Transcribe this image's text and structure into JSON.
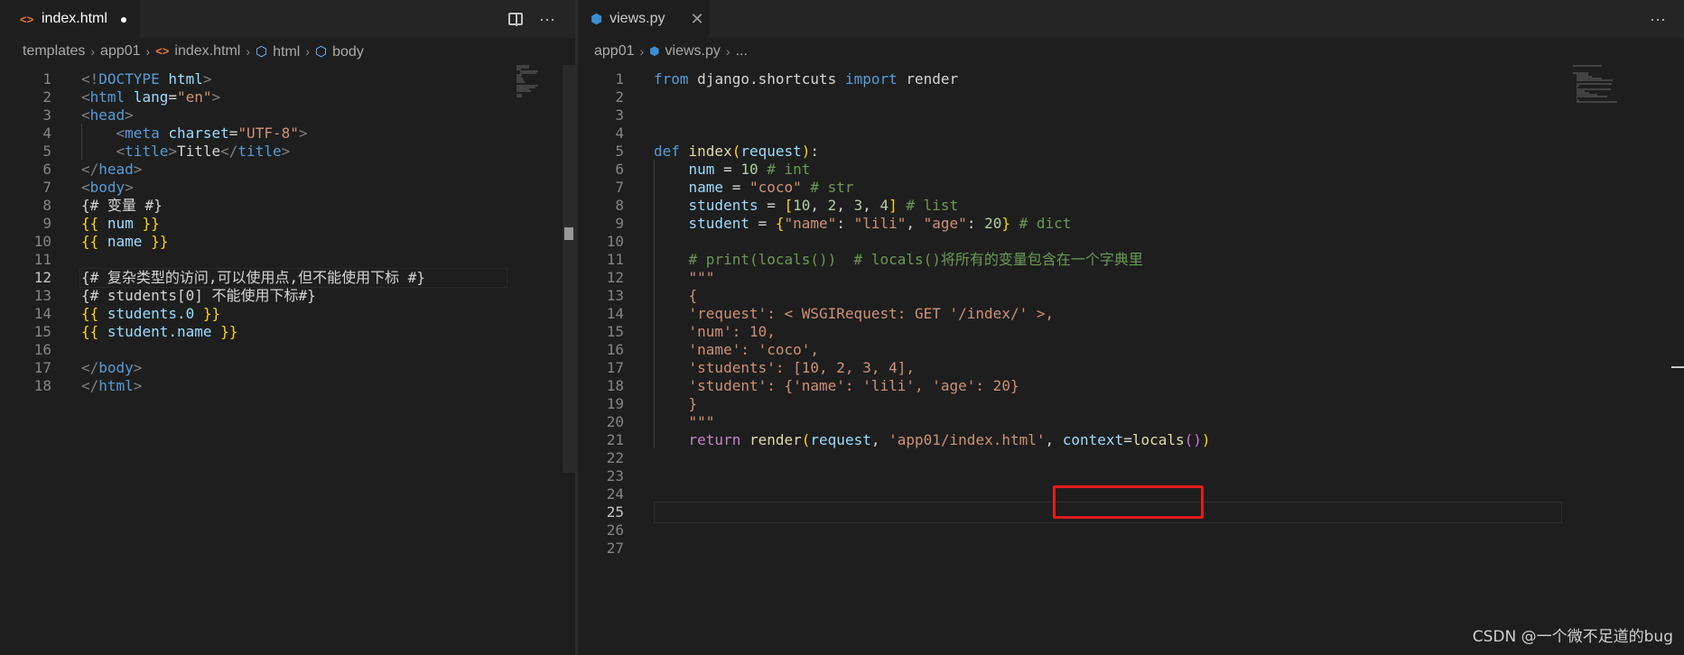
{
  "left_pane": {
    "tab": {
      "label": "index.html",
      "icon": "html-file-icon",
      "modified_dot": "●"
    },
    "breadcrumb": [
      "templates",
      "app01",
      "index.html",
      "html",
      "body"
    ],
    "active_line": 12,
    "lines": [
      {
        "n": "1",
        "tokens": [
          [
            "punc",
            "<!"
          ],
          [
            "tag",
            "DOCTYPE "
          ],
          [
            "attr",
            "html"
          ],
          [
            "punc",
            ">"
          ]
        ]
      },
      {
        "n": "2",
        "tokens": [
          [
            "punc",
            "<"
          ],
          [
            "tag",
            "html "
          ],
          [
            "attr",
            "lang"
          ],
          [
            "txt",
            "="
          ],
          [
            "str",
            "\"en\""
          ],
          [
            "punc",
            ">"
          ]
        ]
      },
      {
        "n": "3",
        "tokens": [
          [
            "punc",
            "<"
          ],
          [
            "tag",
            "head"
          ],
          [
            "punc",
            ">"
          ]
        ]
      },
      {
        "n": "4",
        "tokens": [
          [
            "txt",
            "    "
          ],
          [
            "punc",
            "<"
          ],
          [
            "tag",
            "meta "
          ],
          [
            "attr",
            "charset"
          ],
          [
            "txt",
            "="
          ],
          [
            "str",
            "\"UTF-8\""
          ],
          [
            "punc",
            ">"
          ]
        ]
      },
      {
        "n": "5",
        "tokens": [
          [
            "txt",
            "    "
          ],
          [
            "punc",
            "<"
          ],
          [
            "tag",
            "title"
          ],
          [
            "punc",
            ">"
          ],
          [
            "txt",
            "Title"
          ],
          [
            "punc",
            "</"
          ],
          [
            "tag",
            "title"
          ],
          [
            "punc",
            ">"
          ]
        ]
      },
      {
        "n": "6",
        "tokens": [
          [
            "punc",
            "</"
          ],
          [
            "tag",
            "head"
          ],
          [
            "punc",
            ">"
          ]
        ]
      },
      {
        "n": "7",
        "tokens": [
          [
            "punc",
            "<"
          ],
          [
            "tag",
            "body"
          ],
          [
            "punc",
            ">"
          ]
        ]
      },
      {
        "n": "8",
        "tokens": [
          [
            "txt",
            "{# 变量 #}"
          ]
        ]
      },
      {
        "n": "9",
        "tokens": [
          [
            "brace",
            "{{ "
          ],
          [
            "var",
            "num"
          ],
          [
            "brace",
            " }}"
          ]
        ]
      },
      {
        "n": "10",
        "tokens": [
          [
            "brace",
            "{{ "
          ],
          [
            "var",
            "name"
          ],
          [
            "brace",
            " }}"
          ]
        ]
      },
      {
        "n": "11",
        "tokens": []
      },
      {
        "n": "12",
        "tokens": [
          [
            "txt",
            "{# 复杂类型的访问,可以使用点,但不能使用下标 #}"
          ]
        ]
      },
      {
        "n": "13",
        "tokens": [
          [
            "txt",
            "{# students[0] 不能使用下标#}"
          ]
        ]
      },
      {
        "n": "14",
        "tokens": [
          [
            "brace",
            "{{ "
          ],
          [
            "var",
            "students.0"
          ],
          [
            "brace",
            " }}"
          ]
        ]
      },
      {
        "n": "15",
        "tokens": [
          [
            "brace",
            "{{ "
          ],
          [
            "var",
            "student.name"
          ],
          [
            "brace",
            " }}"
          ]
        ]
      },
      {
        "n": "16",
        "tokens": []
      },
      {
        "n": "17",
        "tokens": [
          [
            "punc",
            "</"
          ],
          [
            "tag",
            "body"
          ],
          [
            "punc",
            ">"
          ]
        ]
      },
      {
        "n": "18",
        "tokens": [
          [
            "punc",
            "</"
          ],
          [
            "tag",
            "html"
          ],
          [
            "punc",
            ">"
          ]
        ]
      }
    ]
  },
  "right_pane": {
    "tab": {
      "label": "views.py",
      "icon": "python-file-icon",
      "close": "✕"
    },
    "breadcrumb": [
      "app01",
      "views.py",
      "..."
    ],
    "active_line": 25,
    "lines": [
      {
        "n": "1",
        "tokens": [
          [
            "kw",
            "from "
          ],
          [
            "txt",
            "django.shortcuts "
          ],
          [
            "kw",
            "import "
          ],
          [
            "txt",
            "render"
          ]
        ]
      },
      {
        "n": "2",
        "tokens": []
      },
      {
        "n": "3",
        "tokens": []
      },
      {
        "n": "4",
        "tokens": []
      },
      {
        "n": "5",
        "tokens": [
          [
            "kw",
            "def "
          ],
          [
            "fn",
            "index"
          ],
          [
            "brace",
            "("
          ],
          [
            "var",
            "request"
          ],
          [
            "brace",
            ")"
          ],
          [
            "txt",
            ":"
          ]
        ]
      },
      {
        "n": "6",
        "tokens": [
          [
            "txt",
            "    "
          ],
          [
            "var",
            "num"
          ],
          [
            "txt",
            " = "
          ],
          [
            "num",
            "10"
          ],
          [
            "cmt",
            " # int"
          ]
        ]
      },
      {
        "n": "7",
        "tokens": [
          [
            "txt",
            "    "
          ],
          [
            "var",
            "name"
          ],
          [
            "txt",
            " = "
          ],
          [
            "str",
            "\"coco\""
          ],
          [
            "cmt",
            " # str"
          ]
        ]
      },
      {
        "n": "8",
        "tokens": [
          [
            "txt",
            "    "
          ],
          [
            "var",
            "students"
          ],
          [
            "txt",
            " = "
          ],
          [
            "brace",
            "["
          ],
          [
            "num",
            "10"
          ],
          [
            "txt",
            ", "
          ],
          [
            "num",
            "2"
          ],
          [
            "txt",
            ", "
          ],
          [
            "num",
            "3"
          ],
          [
            "txt",
            ", "
          ],
          [
            "num",
            "4"
          ],
          [
            "brace",
            "]"
          ],
          [
            "cmt",
            " # list"
          ]
        ]
      },
      {
        "n": "9",
        "tokens": [
          [
            "txt",
            "    "
          ],
          [
            "var",
            "student"
          ],
          [
            "txt",
            " = "
          ],
          [
            "brace",
            "{"
          ],
          [
            "str",
            "\"name\""
          ],
          [
            "txt",
            ": "
          ],
          [
            "str",
            "\"lili\""
          ],
          [
            "txt",
            ", "
          ],
          [
            "str",
            "\"age\""
          ],
          [
            "txt",
            ": "
          ],
          [
            "num",
            "20"
          ],
          [
            "brace",
            "}"
          ],
          [
            "cmt",
            " # dict"
          ]
        ]
      },
      {
        "n": "10",
        "tokens": []
      },
      {
        "n": "11",
        "tokens": [
          [
            "txt",
            "    "
          ],
          [
            "cmt",
            "# print(locals())  # locals()将所有的变量包含在一个字典里"
          ]
        ]
      },
      {
        "n": "12",
        "tokens": [
          [
            "txt",
            "    "
          ],
          [
            "str",
            "\"\"\""
          ]
        ]
      },
      {
        "n": "13",
        "tokens": [
          [
            "txt",
            "    "
          ],
          [
            "str",
            "{"
          ]
        ]
      },
      {
        "n": "14",
        "tokens": [
          [
            "txt",
            "    "
          ],
          [
            "str",
            "'request': < WSGIRequest: GET '/index/' >,"
          ]
        ]
      },
      {
        "n": "15",
        "tokens": [
          [
            "txt",
            "    "
          ],
          [
            "str",
            "'num': 10,"
          ]
        ]
      },
      {
        "n": "16",
        "tokens": [
          [
            "txt",
            "    "
          ],
          [
            "str",
            "'name': 'coco',"
          ]
        ]
      },
      {
        "n": "17",
        "tokens": [
          [
            "txt",
            "    "
          ],
          [
            "str",
            "'students': [10, 2, 3, 4],"
          ]
        ]
      },
      {
        "n": "18",
        "tokens": [
          [
            "txt",
            "    "
          ],
          [
            "str",
            "'student': {'name': 'lili', 'age': 20}"
          ]
        ]
      },
      {
        "n": "19",
        "tokens": [
          [
            "txt",
            "    "
          ],
          [
            "str",
            "}"
          ]
        ]
      },
      {
        "n": "20",
        "tokens": [
          [
            "txt",
            "    "
          ],
          [
            "str",
            "\"\"\""
          ]
        ]
      },
      {
        "n": "21",
        "tokens": [
          [
            "txt",
            "    "
          ],
          [
            "ctl",
            "return "
          ],
          [
            "fn",
            "render"
          ],
          [
            "brace",
            "("
          ],
          [
            "var",
            "request"
          ],
          [
            "txt",
            ", "
          ],
          [
            "str",
            "'app01/index.html'"
          ],
          [
            "txt",
            ", "
          ],
          [
            "var",
            "context"
          ],
          [
            "txt",
            "="
          ],
          [
            "fn",
            "locals"
          ],
          [
            "br2",
            "()"
          ],
          [
            "brace",
            ")"
          ]
        ]
      },
      {
        "n": "22",
        "tokens": []
      },
      {
        "n": "23",
        "tokens": []
      },
      {
        "n": "24",
        "tokens": []
      },
      {
        "n": "25",
        "tokens": []
      },
      {
        "n": "26",
        "tokens": []
      },
      {
        "n": "27",
        "tokens": []
      }
    ]
  },
  "more_actions": "···",
  "watermark": "CSDN @一个微不足道的bug"
}
